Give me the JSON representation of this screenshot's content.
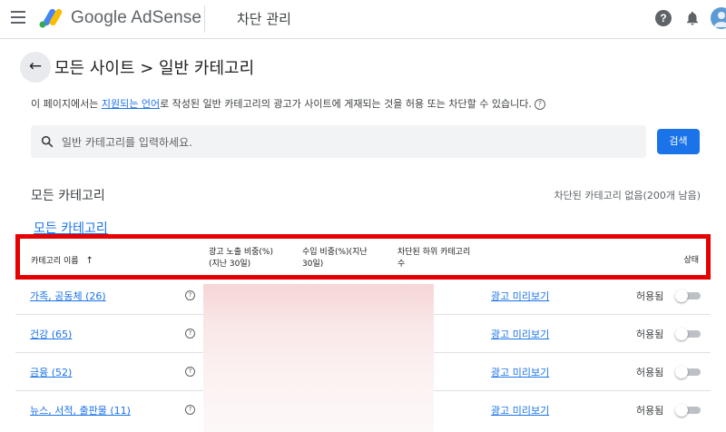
{
  "app": {
    "brand": "Google AdSense",
    "section": "차단 관리",
    "help_icon": "help-icon",
    "bell_icon": "notifications-icon",
    "avatar_icon": "account-avatar"
  },
  "header": {
    "back_icon": "arrow-back-icon",
    "title": "모든 사이트 > 일반 카테고리"
  },
  "description": {
    "before": "이 페이지에서는 ",
    "link": "지원되는 언어",
    "after": "로 작성된 일반 카테고리의 광고가 사이트에 게재되는 것을 허용 또는 차단할 수 있습니다."
  },
  "search": {
    "placeholder": "일반 카테고리를 입력하세요.",
    "button": "검색"
  },
  "section": {
    "heading": "모든 카테고리",
    "blocked_status": "차단된 카테고리 없음(200개 남음)",
    "link": "모든 카테고리"
  },
  "table": {
    "headers": {
      "name": "카테고리 이름",
      "sort_icon": "arrow-upward-icon",
      "impressions_1": "광고 노출 비중(%)",
      "impressions_2": "(지난 30일)",
      "revenue_1": "수입 비중(%)(지난",
      "revenue_2": "30일)",
      "subcats_1": "차단된 하위 카테고리",
      "subcats_2": "수",
      "status": "상태"
    },
    "rows": [
      {
        "name": "가족, 공동체 (26)",
        "preview": "광고 미리보기",
        "status": "허용됨",
        "toggle_on": false
      },
      {
        "name": "건강 (65)",
        "preview": "광고 미리보기",
        "status": "허용됨",
        "toggle_on": false
      },
      {
        "name": "금융 (52)",
        "preview": "광고 미리보기",
        "status": "허용됨",
        "toggle_on": false
      },
      {
        "name": "뉴스, 서적, 출판물 (11)",
        "preview": "광고 미리보기",
        "status": "허용됨",
        "toggle_on": false
      }
    ]
  },
  "colors": {
    "accent": "#1a73e8",
    "highlight": "#e60000"
  }
}
